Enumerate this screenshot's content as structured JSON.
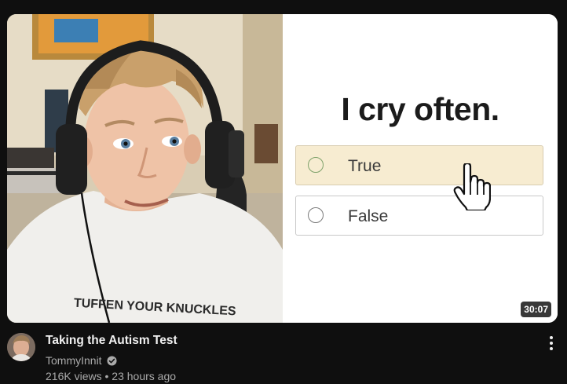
{
  "thumbnail": {
    "quiz": {
      "question": "I cry often.",
      "options": [
        {
          "label": "True",
          "highlighted": true
        },
        {
          "label": "False",
          "highlighted": false
        }
      ]
    },
    "shirt_text": "TUFFEN YOUR KNUCKLES",
    "duration": "30:07"
  },
  "video": {
    "title": "Taking the Autism Test",
    "channel": "TommyInnit",
    "views": "216K views",
    "separator": "•",
    "age": "23 hours ago"
  },
  "icons": {
    "verified": "verified-check-icon",
    "menu": "more-vertical-icon",
    "cursor": "hand-pointer-icon"
  },
  "colors": {
    "background": "#0f0f0f",
    "title": "#f1f1f1",
    "secondary": "#aaaaaa",
    "highlight_option": "#f7ecd1"
  }
}
